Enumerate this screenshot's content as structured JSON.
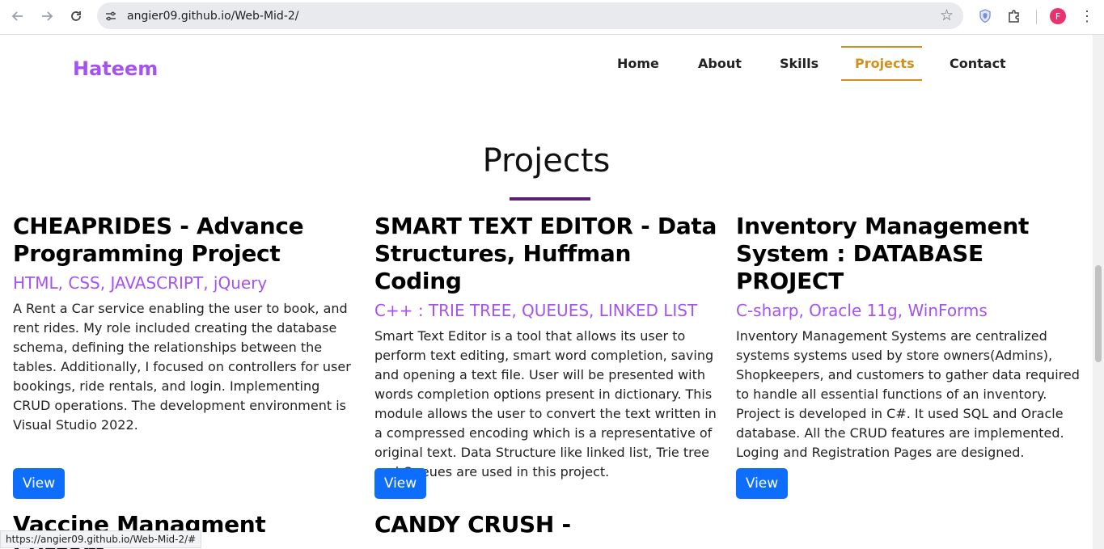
{
  "browser": {
    "url": "angier09.github.io/Web-Mid-2/",
    "profile_initial": "F",
    "status_url": "https://angier09.github.io/Web-Mid-2/#"
  },
  "site": {
    "brand": "Hateem",
    "menu": [
      "Home",
      "About",
      "Skills",
      "Projects",
      "Contact"
    ],
    "active_menu": "Projects",
    "accent_color": "#d4901a",
    "brand_color": "#a553f0"
  },
  "projects_section": {
    "title": "Projects",
    "view_label": "View",
    "projects": [
      {
        "title": "CHEAPRIDES - Advance Programming Project",
        "tech": "HTML, CSS, JAVASCRIPT, jQuery",
        "description": "A Rent a Car service enabling the user to book, and rent rides. My role included creating the database schema, defining the relationships between the tables. Additionally, I focused on controllers for user bookings, ride rentals, and login. Implementing CRUD operations. The development environment is Visual Studio 2022."
      },
      {
        "title": "SMART TEXT EDITOR - Data Structures, Huffman Coding",
        "tech": "C++ : TRIE TREE, QUEUES, LINKED LIST",
        "description": "Smart Text Editor is a tool that allows its user to perform text editing, smart word completion, saving and opening a text file. User will be presented with words completion options present in dictionary. This module allows the user to convert the text written in a compressed encoding which is a representative of original text. Data Structure like linked list, Trie tree and Queues are used in this project."
      },
      {
        "title": "Inventory Management System : DATABASE PROJECT",
        "tech": "C-sharp, Oracle 11g, WinForms",
        "description": "Inventory Management Systems are centralized systems systems used by store owners(Admins), Shopkeepers, and customers to gather data required to handle all essential functions of an inventory. Project is developed in C#. It used SQL and Oracle database. All the CRUD features are implemented. Loging and Registration Pages are designed."
      },
      {
        "title": "Vaccine Managment System",
        "tech": "",
        "description": ""
      },
      {
        "title": "CANDY CRUSH -",
        "tech": "",
        "description": ""
      }
    ]
  }
}
